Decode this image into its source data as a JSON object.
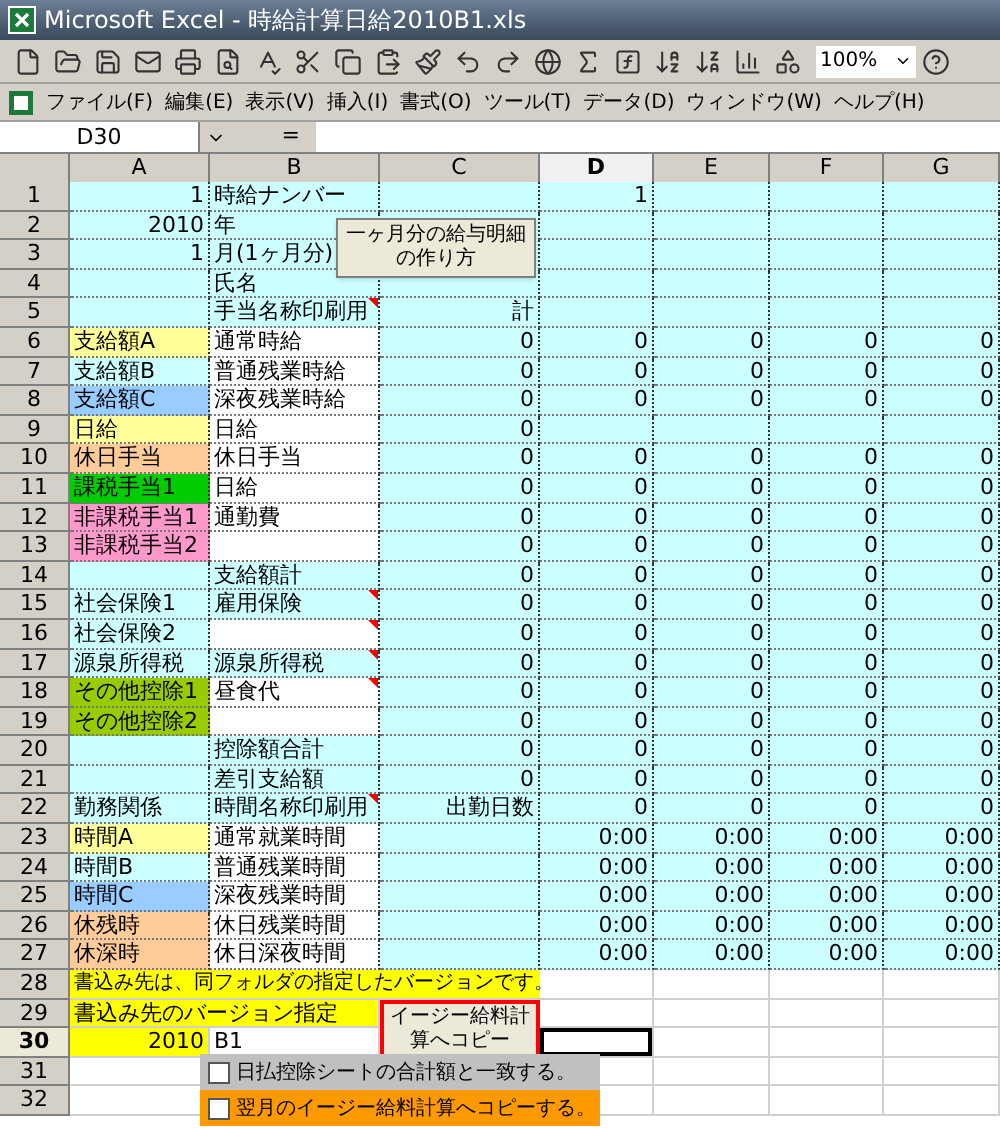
{
  "window": {
    "title": "Microsoft Excel - 時給計算日給2010B1.xls"
  },
  "toolbar": {
    "zoom": "100%"
  },
  "menu": [
    "ファイル(F)",
    "編集(E)",
    "表示(V)",
    "挿入(I)",
    "書式(O)",
    "ツール(T)",
    "データ(D)",
    "ウィンドウ(W)",
    "ヘルプ(H)"
  ],
  "formula_bar": {
    "name_box": "D30",
    "equals": "="
  },
  "columns": [
    {
      "label": "A",
      "selected": false
    },
    {
      "label": "B",
      "selected": false
    },
    {
      "label": "C",
      "selected": false
    },
    {
      "label": "D",
      "selected": true
    },
    {
      "label": "E",
      "selected": false
    },
    {
      "label": "F",
      "selected": false
    },
    {
      "label": "G",
      "selected": false
    }
  ],
  "rows": [
    {
      "n": "1",
      "kind": "setting",
      "selected": false,
      "cells": [
        "1",
        "時給ナンバー",
        "",
        "1",
        "",
        "",
        ""
      ]
    },
    {
      "n": "2",
      "kind": "setting",
      "selected": false,
      "cells": [
        "2010",
        "年",
        "",
        "",
        "",
        "",
        ""
      ]
    },
    {
      "n": "3",
      "kind": "setting",
      "selected": false,
      "cells": [
        "1",
        "月(1ヶ月分)",
        "",
        "",
        "",
        "",
        ""
      ]
    },
    {
      "n": "4",
      "kind": "data",
      "selected": false,
      "b_input": false,
      "b_comment": false,
      "cells": [
        "",
        "氏名",
        "",
        "",
        "",
        "",
        ""
      ]
    },
    {
      "n": "5",
      "kind": "data",
      "selected": false,
      "b_input": false,
      "b_comment": true,
      "cells": [
        "",
        "手当名称印刷用",
        "計",
        "",
        "",
        "",
        ""
      ]
    },
    {
      "n": "6",
      "kind": "data",
      "selected": false,
      "b_input": true,
      "b_comment": false,
      "color": "#ffff99",
      "cells": [
        "支給額A",
        "通常時給",
        "0",
        "0",
        "0",
        "0",
        "0"
      ]
    },
    {
      "n": "7",
      "kind": "data",
      "selected": false,
      "b_input": true,
      "b_comment": false,
      "cells": [
        "支給額B",
        "普通残業時給",
        "0",
        "0",
        "0",
        "0",
        "0"
      ]
    },
    {
      "n": "8",
      "kind": "data",
      "selected": false,
      "b_input": true,
      "b_comment": false,
      "color": "#99ccff",
      "cells": [
        "支給額C",
        "深夜残業時給",
        "0",
        "0",
        "0",
        "0",
        "0"
      ]
    },
    {
      "n": "9",
      "kind": "data",
      "selected": false,
      "b_input": true,
      "b_comment": false,
      "color": "#ffff99",
      "cells": [
        "日給",
        "日給",
        "0",
        "",
        "",
        "",
        ""
      ]
    },
    {
      "n": "10",
      "kind": "data",
      "selected": false,
      "b_input": true,
      "b_comment": false,
      "color": "#ffcc99",
      "cells": [
        "休日手当",
        "休日手当",
        "0",
        "0",
        "0",
        "0",
        "0"
      ]
    },
    {
      "n": "11",
      "kind": "data",
      "selected": false,
      "b_input": true,
      "b_comment": false,
      "color": "#00cc00",
      "cells": [
        "課税手当1",
        "日給",
        "0",
        "0",
        "0",
        "0",
        "0"
      ]
    },
    {
      "n": "12",
      "kind": "data",
      "selected": false,
      "b_input": true,
      "b_comment": false,
      "color": "#ff99cc",
      "cells": [
        "非課税手当1",
        "通勤費",
        "0",
        "0",
        "0",
        "0",
        "0"
      ]
    },
    {
      "n": "13",
      "kind": "data",
      "selected": false,
      "b_input": true,
      "b_comment": false,
      "color": "#ff99cc",
      "cells": [
        "非課税手当2",
        "",
        "0",
        "0",
        "0",
        "0",
        "0"
      ]
    },
    {
      "n": "14",
      "kind": "data",
      "selected": false,
      "b_input": false,
      "b_comment": false,
      "cells": [
        "",
        "支給額計",
        "0",
        "0",
        "0",
        "0",
        "0"
      ]
    },
    {
      "n": "15",
      "kind": "data",
      "selected": false,
      "b_input": false,
      "b_comment": true,
      "cells": [
        "社会保険1",
        "雇用保険",
        "0",
        "0",
        "0",
        "0",
        "0"
      ]
    },
    {
      "n": "16",
      "kind": "data",
      "selected": false,
      "b_input": true,
      "b_comment": true,
      "cells": [
        "社会保険2",
        "",
        "0",
        "0",
        "0",
        "0",
        "0"
      ]
    },
    {
      "n": "17",
      "kind": "data",
      "selected": false,
      "b_input": false,
      "b_comment": true,
      "cells": [
        "源泉所得税",
        "源泉所得税",
        "0",
        "0",
        "0",
        "0",
        "0"
      ]
    },
    {
      "n": "18",
      "kind": "data",
      "selected": false,
      "b_input": true,
      "b_comment": true,
      "color": "#99cc00",
      "cells": [
        "その他控除1",
        "昼食代",
        "0",
        "0",
        "0",
        "0",
        "0"
      ]
    },
    {
      "n": "19",
      "kind": "data",
      "selected": false,
      "b_input": true,
      "b_comment": false,
      "color": "#99cc00",
      "cells": [
        "その他控除2",
        "",
        "0",
        "0",
        "0",
        "0",
        "0"
      ]
    },
    {
      "n": "20",
      "kind": "data",
      "selected": false,
      "b_input": false,
      "b_comment": false,
      "cells": [
        "",
        "控除額合計",
        "0",
        "0",
        "0",
        "0",
        "0"
      ]
    },
    {
      "n": "21",
      "kind": "data",
      "selected": false,
      "b_input": false,
      "b_comment": false,
      "cells": [
        "",
        "差引支給額",
        "0",
        "0",
        "0",
        "0",
        "0"
      ]
    },
    {
      "n": "22",
      "kind": "data",
      "selected": false,
      "b_input": false,
      "b_comment": true,
      "cells": [
        "勤務関係",
        "時間名称印刷用",
        "出勤日数",
        "0",
        "0",
        "0",
        "0"
      ]
    },
    {
      "n": "23",
      "kind": "data",
      "selected": false,
      "b_input": true,
      "b_comment": false,
      "color": "#ffff99",
      "cells": [
        "時間A",
        "通常就業時間",
        "",
        "0:00",
        "0:00",
        "0:00",
        "0:00"
      ]
    },
    {
      "n": "24",
      "kind": "data",
      "selected": false,
      "b_input": true,
      "b_comment": false,
      "cells": [
        "時間B",
        "普通残業時間",
        "",
        "0:00",
        "0:00",
        "0:00",
        "0:00"
      ]
    },
    {
      "n": "25",
      "kind": "data",
      "selected": false,
      "b_input": true,
      "b_comment": false,
      "color": "#99ccff",
      "cells": [
        "時間C",
        "深夜残業時間",
        "",
        "0:00",
        "0:00",
        "0:00",
        "0:00"
      ]
    },
    {
      "n": "26",
      "kind": "data",
      "selected": false,
      "b_input": true,
      "b_comment": false,
      "color": "#ffcc99",
      "cells": [
        "休残時",
        "休日残業時間",
        "",
        "0:00",
        "0:00",
        "0:00",
        "0:00"
      ]
    },
    {
      "n": "27",
      "kind": "data",
      "selected": false,
      "b_input": true,
      "b_comment": false,
      "color": "#ffcc99",
      "cells": [
        "休深時",
        "休日深夜時間",
        "",
        "0:00",
        "0:00",
        "0:00",
        "0:00"
      ]
    },
    {
      "n": "28",
      "kind": "note",
      "selected": false,
      "cells": [
        "書込み先は、同フォルダの指定したバージョンです。"
      ]
    },
    {
      "n": "29",
      "kind": "label",
      "selected": false,
      "cells": [
        "書込み先のバージョン指定"
      ]
    },
    {
      "n": "30",
      "kind": "entry",
      "selected": true,
      "cells": [
        "2010",
        "B1"
      ]
    },
    {
      "n": "31",
      "kind": "blank",
      "selected": false
    },
    {
      "n": "32",
      "kind": "blank",
      "selected": false
    }
  ],
  "buttons": [
    {
      "label": "一ヶ月分の給与明細の作り方"
    },
    {
      "label": "イージー給料計算へコピー"
    }
  ],
  "checkboxes": [
    {
      "label": "日払控除シートの合計額と一致する。",
      "checked": false,
      "color": "#c0c0c0"
    },
    {
      "label": "翌月のイージー給料計算へコピーする。",
      "checked": false,
      "color": "#ff9900"
    }
  ]
}
